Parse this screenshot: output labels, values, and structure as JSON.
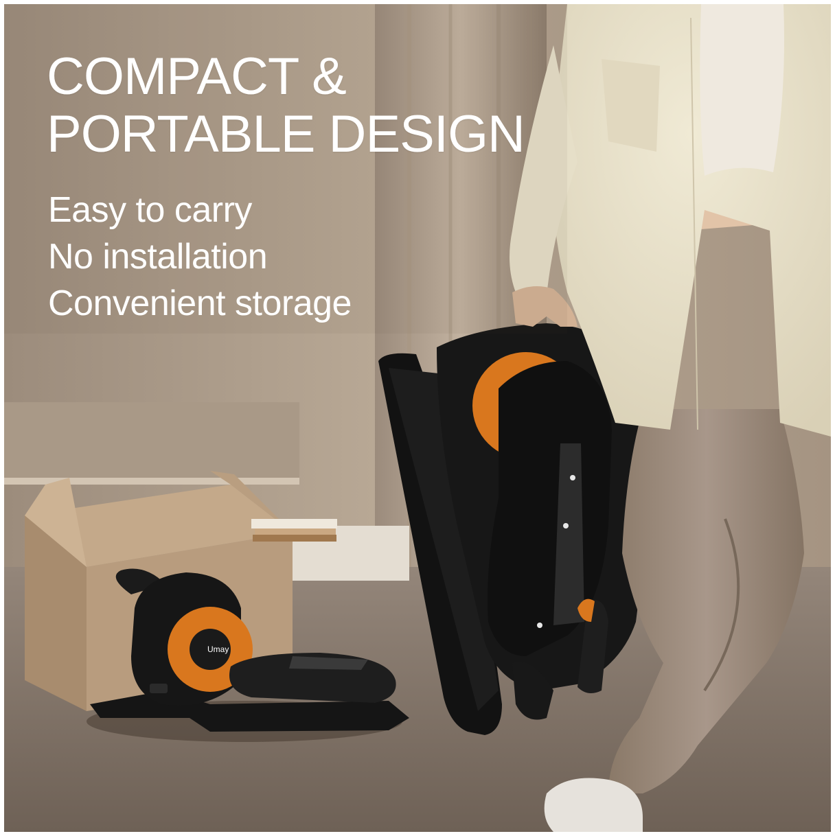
{
  "headline": {
    "line1": "COMPACT &",
    "line2": "PORTABLE DESIGN"
  },
  "features": [
    "Easy to carry",
    "No installation",
    "Convenient storage"
  ],
  "product": {
    "brand_label": "Umay",
    "accent_color": "#d9771e",
    "body_color": "#141414"
  },
  "colors": {
    "wall": "#b3a392",
    "floor": "#8a7b6c",
    "text": "#ffffff"
  }
}
